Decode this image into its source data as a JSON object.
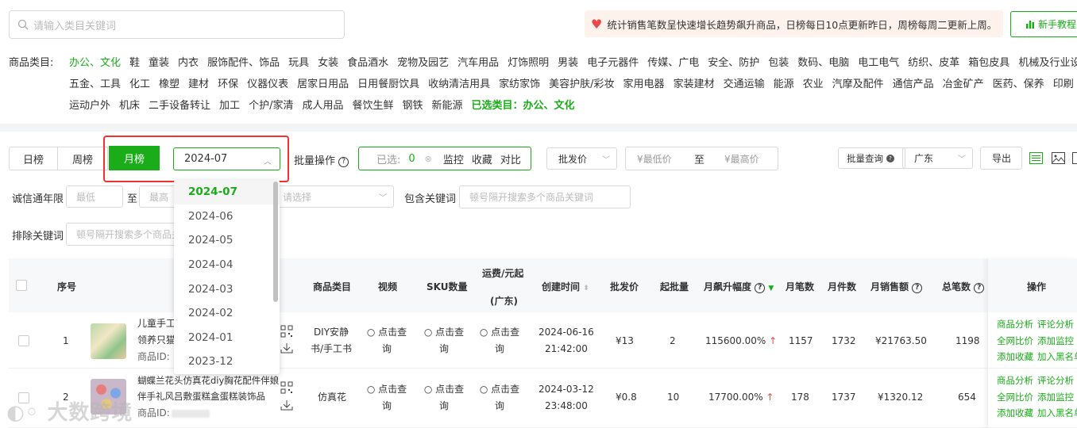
{
  "search": {
    "placeholder": "请输入类目关键词"
  },
  "notice": {
    "text": "统计销售笔数呈快速增长趋势飙升商品，日榜每日10点更新昨日，周榜每周二更新上周。"
  },
  "tutorial_label": "新手教程",
  "categories": {
    "label": "商品类目:",
    "rows": [
      [
        "办公、文化",
        "鞋",
        "童装",
        "内衣",
        "服饰配件、饰品",
        "玩具",
        "女装",
        "食品酒水",
        "宠物及园艺",
        "汽车用品",
        "灯饰照明",
        "男装",
        "电子元器件",
        "传媒、广电",
        "安全、防护",
        "包装",
        "数码、电脑",
        "电工电气",
        "纺织、皮革",
        "箱包皮具",
        "机械及行业设备"
      ],
      [
        "五金、工具",
        "化工",
        "橡塑",
        "建材",
        "环保",
        "仪器仪表",
        "居家日用品",
        "日用餐厨饮具",
        "收纳清洁用具",
        "家纺家饰",
        "美容护肤/彩妆",
        "家用电器",
        "家装建材",
        "交通运输",
        "能源",
        "农业",
        "汽摩及配件",
        "通信产品",
        "冶金矿产",
        "医药、保养",
        "印刷"
      ],
      [
        "运动户外",
        "机床",
        "二手设备转让",
        "加工",
        "个护/家清",
        "成人用品",
        "餐饮生鲜",
        "钢铁",
        "新能源"
      ]
    ],
    "active": "办公、文化",
    "selected_label": "已选类目：办公、文化"
  },
  "rank_tabs": [
    "日榜",
    "周榜",
    "月榜"
  ],
  "active_tab": "月榜",
  "date_select": {
    "value": "2024-07",
    "options": [
      "2024-07",
      "2024-06",
      "2024-05",
      "2024-04",
      "2024-03",
      "2024-02",
      "2024-01",
      "2023-12"
    ]
  },
  "batch": {
    "label": "批量操作",
    "selected_label": "已选:",
    "selected_count": "0",
    "actions": [
      "监控",
      "收藏",
      "对比"
    ]
  },
  "price_filter": {
    "select": "批发价",
    "min_placeholder": "¥最低价",
    "to": "至",
    "max_placeholder": "¥最高价"
  },
  "batch_query": {
    "label": "批量查询",
    "region": "广东",
    "export": "导出"
  },
  "filters": {
    "integrity_label": "诚信通年限",
    "min_placeholder": "最低",
    "to": "至",
    "max_placeholder": "最高",
    "select_placeholder": "请选择",
    "include_label": "包含关键词",
    "include_placeholder": "顿号隔开搜索多个商品关键词",
    "exclude_label": "排除关键词",
    "exclude_placeholder": "顿号隔开搜索多个商品关键词"
  },
  "table": {
    "headers": {
      "index": "序号",
      "category": "商品类目",
      "video": "视频",
      "sku": "SKU数量",
      "freight": "运费/元起",
      "freight_region": "(广东)",
      "created": "创建时间",
      "price": "批发价",
      "moq": "起批量",
      "growth": "月飙升幅度",
      "orders": "月笔数",
      "units": "月件数",
      "sales": "月销售额",
      "total_orders": "总笔数",
      "actions": "操作"
    },
    "rows": [
      {
        "index": "1",
        "title_l1": "儿童手工...",
        "title_l2": "领养只猫...",
        "id_label": "商品ID:",
        "category": "DIY安静书/手工书",
        "video": "点击查询",
        "sku": "点击查询",
        "freight": "点击查询",
        "created_date": "2024-06-16",
        "created_time": "21:42:00",
        "price": "¥13",
        "moq": "2",
        "growth": "115600.00%",
        "orders": "1157",
        "units": "1732",
        "sales": "¥21763.50",
        "total_orders": "1198"
      },
      {
        "index": "2",
        "title_l1": "蝴蝶兰花头仿真花diy胸花配件伴娘",
        "title_l2": "伴手礼风吕敷蛋糕盒蛋糕装饰品",
        "id_label": "商品ID:",
        "category": "仿真花",
        "video": "点击查询",
        "sku": "点击查询",
        "freight": "点击查询",
        "created_date": "2024-03-12",
        "created_time": "23:48:00",
        "price": "¥0.8",
        "moq": "10",
        "growth": "17700.00%",
        "orders": "178",
        "units": "1737",
        "sales": "¥1320.12",
        "total_orders": "654"
      }
    ],
    "row_actions": [
      "商品分析",
      "评论分析",
      "全网比价",
      "添加监控",
      "添加收藏",
      "加入黑名单"
    ]
  },
  "watermark": "大数跨境",
  "colors": {
    "accent": "#1aad19",
    "highlight_border": "#e33333",
    "up_arrow": "#e94b4b"
  }
}
